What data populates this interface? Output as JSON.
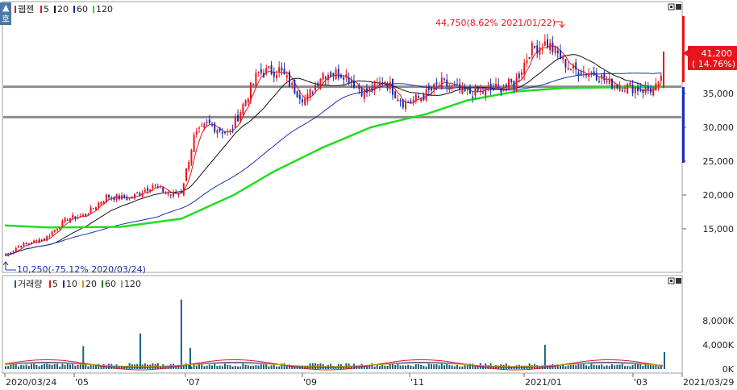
{
  "colors": {
    "up": "#e8141c",
    "down": "#1a2fb0",
    "ma5": "#e8141c",
    "ma20": "#111111",
    "ma60": "#1a2fb0",
    "ma120": "#22dd22",
    "vol_ma20": "#d4a000",
    "vol_ma60": "#208020",
    "vol_ma120": "#9a9a9a",
    "vol_bar": "#1a6080",
    "hline": "#8c8c8c",
    "border": "#a0a0a0"
  },
  "top_legend": {
    "corner_icon": "stock-toggle-icon",
    "items": [
      {
        "label": "웹젠",
        "color": "#e8141c"
      },
      {
        "label": "5",
        "color": "#e8141c"
      },
      {
        "label": "20",
        "color": "#111111"
      },
      {
        "label": "60",
        "color": "#1a2fb0"
      },
      {
        "label": "120",
        "color": "#22dd22"
      }
    ]
  },
  "volume_legend": {
    "items": [
      {
        "label": "거래량",
        "color": "#1a6080"
      },
      {
        "label": "5",
        "color": "#e8141c"
      },
      {
        "label": "10",
        "color": "#1a2fb0"
      },
      {
        "label": "20",
        "color": "#d4a000"
      },
      {
        "label": "60",
        "color": "#208020"
      },
      {
        "label": "120",
        "color": "#9a9a9a"
      }
    ]
  },
  "annotations": {
    "high": "44,750(8.62% 2021/01/22)",
    "low": "10,250(-75.12% 2020/03/24)",
    "current_price": "41,200",
    "current_change": "( 14.76%)"
  },
  "chart_data": {
    "type": "candlestick",
    "title": "웹젠",
    "x_ticks": [
      "2020/03/24",
      "'05",
      "'07",
      "'09",
      "'11",
      "2021/01",
      "'03",
      "2021/03/29"
    ],
    "date_range": [
      "2020/03/24",
      "2021/03/29"
    ],
    "price_axis": {
      "ticks": [
        "35,000",
        "30,000",
        "25,000",
        "20,000",
        "15,000"
      ],
      "ylim": [
        9000,
        48000
      ]
    },
    "volume_axis": {
      "ticks": [
        "8,000K",
        "4,000K",
        "0K"
      ],
      "ylim": [
        0,
        12000
      ]
    },
    "horizontal_lines": [
      36000,
      31500
    ],
    "current_price": 41200,
    "high": {
      "value": 44750,
      "date": "2021/01/22"
    },
    "low": {
      "value": 10250,
      "date": "2020/03/24"
    },
    "close_trend": [
      [
        "2020/03/24",
        11000
      ],
      [
        "2020/04/01",
        12500
      ],
      [
        "2020/04/15",
        13500
      ],
      [
        "2020/04/28",
        16500
      ],
      [
        "2020/05/08",
        17000
      ],
      [
        "2020/05/20",
        19800
      ],
      [
        "2020/06/02",
        19500
      ],
      [
        "2020/06/15",
        21500
      ],
      [
        "2020/06/25",
        20000
      ],
      [
        "2020/07/01",
        20500
      ],
      [
        "2020/07/08",
        28500
      ],
      [
        "2020/07/16",
        30500
      ],
      [
        "2020/07/28",
        29000
      ],
      [
        "2020/08/05",
        33500
      ],
      [
        "2020/08/13",
        38000
      ],
      [
        "2020/08/25",
        38500
      ],
      [
        "2020/09/01",
        36000
      ],
      [
        "2020/09/09",
        34000
      ],
      [
        "2020/09/18",
        38000
      ],
      [
        "2020/09/30",
        38000
      ],
      [
        "2020/10/12",
        35000
      ],
      [
        "2020/10/23",
        37000
      ],
      [
        "2020/11/03",
        33500
      ],
      [
        "2020/11/13",
        34500
      ],
      [
        "2020/11/24",
        36500
      ],
      [
        "2020/12/08",
        35000
      ],
      [
        "2020/12/21",
        35500
      ],
      [
        "2021/01/04",
        36500
      ],
      [
        "2021/01/13",
        41500
      ],
      [
        "2021/01/22",
        42500
      ],
      [
        "2021/02/05",
        38500
      ],
      [
        "2021/02/18",
        38000
      ],
      [
        "2021/02/26",
        36500
      ],
      [
        "2021/03/09",
        36000
      ],
      [
        "2021/03/19",
        35500
      ],
      [
        "2021/03/26",
        35900
      ],
      [
        "2021/03/29",
        41200
      ]
    ],
    "volume_spikes_k": [
      [
        "2020/05/07",
        3800
      ],
      [
        "2020/06/08",
        5900
      ],
      [
        "2020/07/01",
        11500
      ],
      [
        "2020/07/06",
        3500
      ],
      [
        "2021/01/21",
        4000
      ],
      [
        "2021/03/29",
        2800
      ]
    ],
    "volume_baseline_k": 700
  }
}
